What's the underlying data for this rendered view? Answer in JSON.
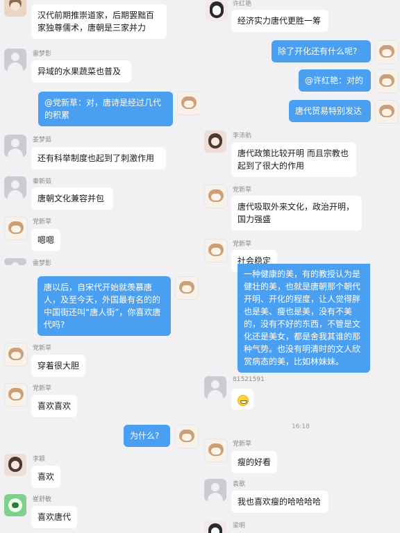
{
  "left_panel": {
    "messages": [
      {
        "kind": "incoming",
        "avatar_icon": "tan-avatar-icon",
        "name": "",
        "text": "汉代前期推崇道家，后期罢黜百家独尊儒术，唐朝是三家并力"
      },
      {
        "kind": "incoming",
        "avatar_icon": "default-avatar-icon",
        "name": "雷梦影",
        "text": "异域的水果蔬菜也普及"
      },
      {
        "kind": "outgoing",
        "avatar_icon": "cat-avatar-icon",
        "text": "@党新草：对，唐诗是经过几代的积累"
      },
      {
        "kind": "incoming",
        "avatar_icon": "default-avatar-icon",
        "name": "姜梦茹",
        "text": "还有科举制度也起到了刺激作用"
      },
      {
        "kind": "incoming",
        "avatar_icon": "default-avatar-icon",
        "name": "秦新茹",
        "text": "唐朝文化兼容并包"
      },
      {
        "kind": "incoming",
        "avatar_icon": "cat-avatar-icon",
        "name": "党新草",
        "text": "嗯嗯"
      },
      {
        "kind": "name_only",
        "name": "雷梦影"
      },
      {
        "kind": "outgoing",
        "avatar_icon": "cat-avatar-icon",
        "text": "唐以后，自宋代开始就羡慕唐人，及至今天，外国最有名的的中国街还叫“唐人街”，你喜欢唐代吗?"
      },
      {
        "kind": "incoming",
        "avatar_icon": "cat-avatar-icon",
        "name": "党新草",
        "text": "穿着很大胆"
      },
      {
        "kind": "incoming",
        "avatar_icon": "cat-avatar-icon",
        "name": "党新草",
        "text": "喜欢喜欢"
      },
      {
        "kind": "outgoing",
        "avatar_icon": "cat-avatar-icon",
        "text": "为什么?"
      },
      {
        "kind": "incoming",
        "avatar_icon": "girl-avatar-icon",
        "name": "李颖",
        "text": "喜欢"
      },
      {
        "kind": "incoming",
        "avatar_icon": "green-avatar-icon",
        "name": "崔舒敏",
        "text": "喜欢唐代"
      }
    ]
  },
  "right_panel": {
    "messages": [
      {
        "kind": "incoming",
        "avatar_icon": "anime-avatar-icon",
        "name": "许红艳",
        "text": "经济实力唐代更胜一筹"
      },
      {
        "kind": "outgoing",
        "avatar_icon": "cat-avatar-icon",
        "text": "除了开化还有什么呢?"
      },
      {
        "kind": "outgoing",
        "avatar_icon": "cat-avatar-icon",
        "text": "@许红艳：对的"
      },
      {
        "kind": "outgoing",
        "avatar_icon": "cat-avatar-icon",
        "text": "唐代贸易特别发达"
      },
      {
        "kind": "incoming",
        "avatar_icon": "girl-avatar-icon",
        "name": "李沛航",
        "text": "唐代政策比较开明 而且宗教也起到了很大的作用"
      },
      {
        "kind": "incoming",
        "avatar_icon": "cat-avatar-icon",
        "name": "党新草",
        "text": "唐代吸取外来文化，政治开明，国力强盛"
      },
      {
        "kind": "incoming",
        "avatar_icon": "cat-avatar-icon",
        "name": "党新草",
        "text": "社会稳定"
      },
      {
        "kind": "outgoing_partial",
        "text": "一种健康的美，有的教授认为是健壮的美，也就是唐朝那个朝代开明、开化的程度，让人觉得胖也是美、瘦也是美，没有不美的，没有不好的东西，不管是文化还是美女，都是舍我其谁的那种气势。也没有明清时的文人欣赏病态的美，比如林妹妹。"
      },
      {
        "kind": "incoming",
        "avatar_icon": "default-avatar-icon",
        "name": "81521591",
        "emoji": "grin-emoji-icon"
      },
      {
        "kind": "time",
        "text": "16:18"
      },
      {
        "kind": "incoming",
        "avatar_icon": "cat-avatar-icon",
        "name": "党新草",
        "text": "瘦的好看"
      },
      {
        "kind": "incoming",
        "avatar_icon": "default-avatar-icon",
        "name": "袁歌",
        "text": "我也喜欢瘦的哈哈哈哈"
      },
      {
        "kind": "name_only",
        "avatar_icon": "anime-avatar-icon",
        "name": "梁明"
      }
    ]
  }
}
